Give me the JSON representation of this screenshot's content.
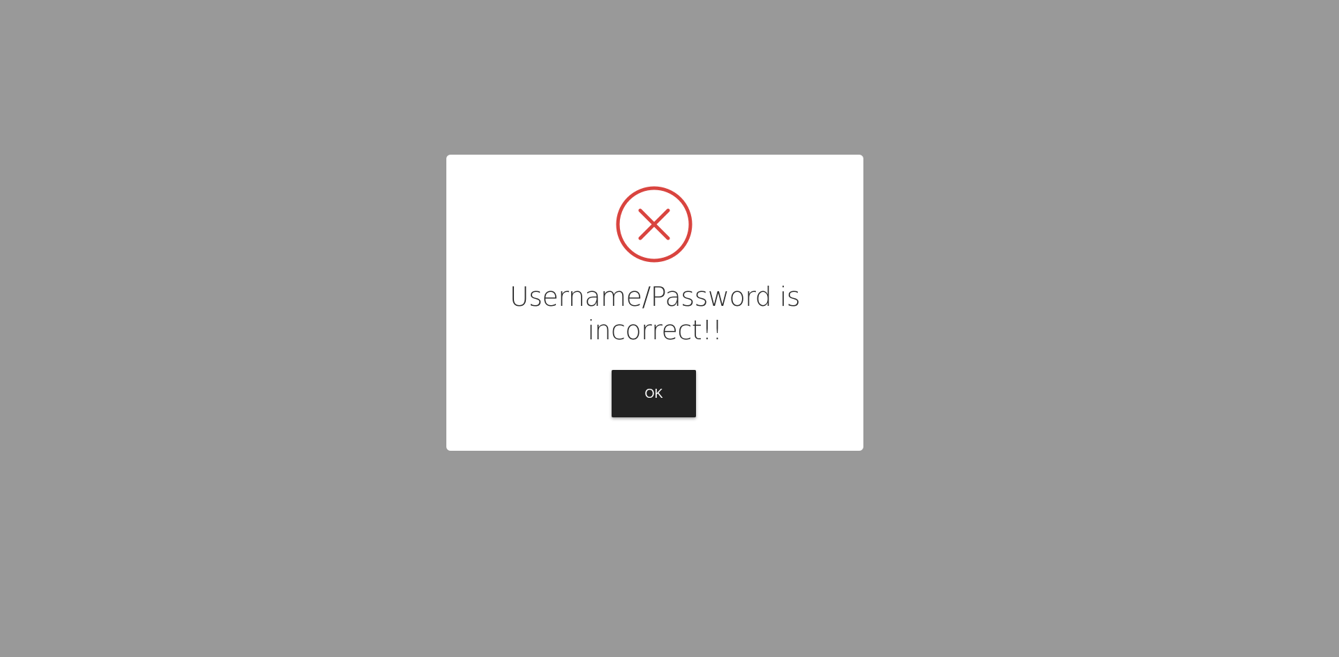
{
  "dialog": {
    "icon": "error-x-circle-icon",
    "message": "Username/Password is incorrect!!",
    "ok_label": "OK"
  },
  "colors": {
    "backdrop": "#999999",
    "dialog_background": "#ffffff",
    "error_accent": "#d9443f",
    "button_background": "#222222",
    "button_text": "#ffffff",
    "message_text": "#2b2b2b"
  }
}
